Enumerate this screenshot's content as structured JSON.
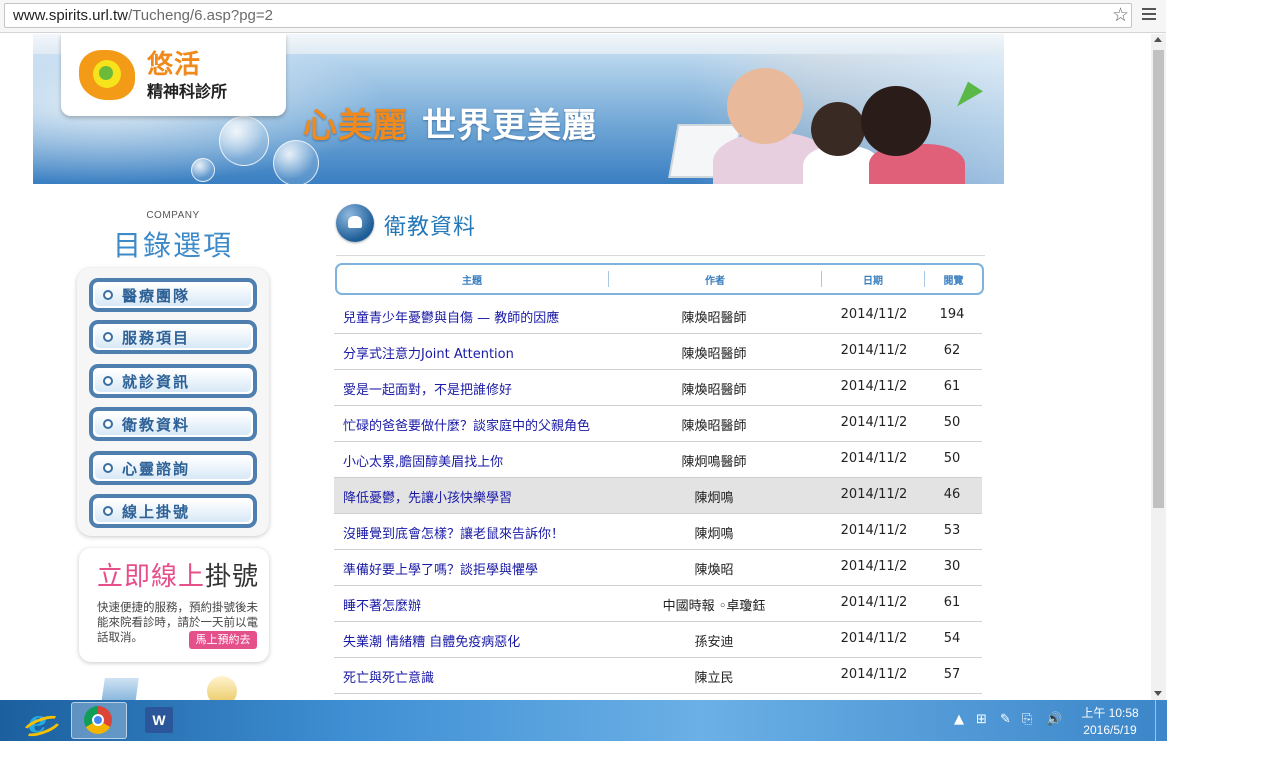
{
  "browser": {
    "url_host": "www.spirits.url.tw",
    "url_path": "/Tucheng/6.asp?pg=2",
    "star_icon": "star-icon",
    "menu_icon": "hamburger-menu-icon"
  },
  "banner": {
    "logo_name": "悠活",
    "logo_sub": "精神科診所",
    "slogan_accent": "心美麗",
    "slogan_rest": "世界更美麗"
  },
  "sidebar": {
    "company": "COMPANY",
    "title": "目錄選項",
    "items": [
      {
        "label": "醫療團隊"
      },
      {
        "label": "服務項目"
      },
      {
        "label": "就診資訊"
      },
      {
        "label": "衛教資料"
      },
      {
        "label": "心靈諮詢"
      },
      {
        "label": "線上掛號"
      }
    ],
    "register": {
      "title_pink": "立即線上",
      "title_dark": "掛號",
      "desc": "快速便捷的服務，預約掛號後未能來院看診時，請於一天前以電話取消。",
      "button": "馬上預約去"
    }
  },
  "content": {
    "title": "衛教資料",
    "headers": {
      "title": "主題",
      "author": "作者",
      "date": "日期",
      "views": "閱覽"
    },
    "rows": [
      {
        "title": "兒童青少年憂鬱與自傷 — 教師的因應",
        "author": "陳煥昭醫師",
        "date": "2014/11/2",
        "views": "194"
      },
      {
        "title": "分享式注意力Joint Attention",
        "author": "陳煥昭醫師",
        "date": "2014/11/2",
        "views": "62"
      },
      {
        "title": "愛是一起面對，不是把誰修好",
        "author": "陳煥昭醫師",
        "date": "2014/11/2",
        "views": "61"
      },
      {
        "title": "忙碌的爸爸要做什麼？談家庭中的父親角色",
        "author": "陳煥昭醫師",
        "date": "2014/11/2",
        "views": "50"
      },
      {
        "title": "小心太累,膽固醇美眉找上你",
        "author": "陳炯鳴醫師",
        "date": "2014/11/2",
        "views": "50"
      },
      {
        "title": "降低憂鬱，先讓小孩快樂學習",
        "author": "陳炯鳴",
        "date": "2014/11/2",
        "views": "46"
      },
      {
        "title": "沒睡覺到底會怎樣？讓老鼠來告訴你！",
        "author": "陳炯鳴",
        "date": "2014/11/2",
        "views": "53"
      },
      {
        "title": "準備好要上學了嗎？談拒學與懼學",
        "author": "陳煥昭",
        "date": "2014/11/2",
        "views": "30"
      },
      {
        "title": "睡不著怎麼辦",
        "author": "中國時報 ◦卓瓊鈺",
        "date": "2014/11/2",
        "views": "61"
      },
      {
        "title": "失業潮 情緒糟 自體免疫病惡化",
        "author": "孫安迪",
        "date": "2014/11/2",
        "views": "54"
      },
      {
        "title": "死亡與死亡意識",
        "author": "陳立民",
        "date": "2014/11/2",
        "views": "57"
      }
    ],
    "highlighted_row": 5
  },
  "taskbar": {
    "apps": [
      {
        "name": "internet-explorer-icon"
      },
      {
        "name": "chrome-icon",
        "active": true
      },
      {
        "name": "word-icon"
      }
    ],
    "word_glyph": "W",
    "tray_up": "▲",
    "time": "上午 10:58",
    "date": "2016/5/19"
  },
  "colors": {
    "accent_blue": "#2478b8",
    "link": "#1a1aa6",
    "orange": "#f08a1c",
    "pink": "#e6508a"
  }
}
